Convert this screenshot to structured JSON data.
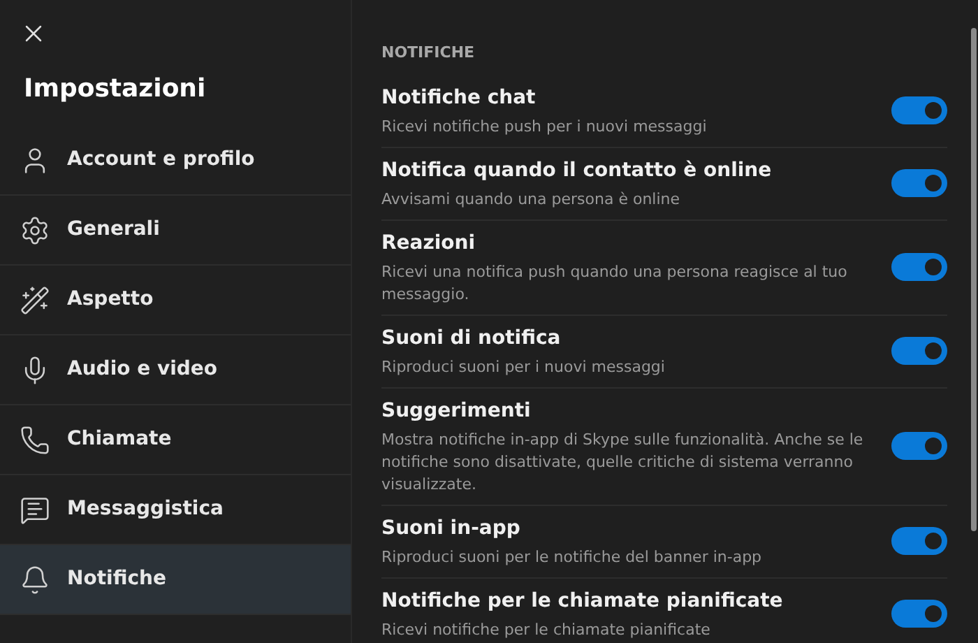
{
  "sidebar": {
    "title": "Impostazioni",
    "items": [
      {
        "kind": "account",
        "label": "Account e profilo",
        "selected": false
      },
      {
        "kind": "general",
        "label": "Generali",
        "selected": false
      },
      {
        "kind": "appearance",
        "label": "Aspetto",
        "selected": false
      },
      {
        "kind": "audio",
        "label": "Audio e video",
        "selected": false
      },
      {
        "kind": "calls",
        "label": "Chiamate",
        "selected": false
      },
      {
        "kind": "messaging",
        "label": "Messaggistica",
        "selected": false
      },
      {
        "kind": "notifications",
        "label": "Notifiche",
        "selected": true
      }
    ]
  },
  "section": {
    "heading": "NOTIFICHE",
    "settings": [
      {
        "title": "Notifiche chat",
        "description": "Ricevi notifiche push per i nuovi messaggi",
        "on": true
      },
      {
        "title": "Notifica quando il contatto è online",
        "description": "Avvisami quando una persona è online",
        "on": true
      },
      {
        "title": "Reazioni",
        "description": "Ricevi una notifica push quando una persona reagisce al tuo messaggio.",
        "on": true
      },
      {
        "title": "Suoni di notifica",
        "description": "Riproduci suoni per i nuovi messaggi",
        "on": true
      },
      {
        "title": "Suggerimenti",
        "description": "Mostra notifiche in-app di Skype sulle funzionalità. Anche se le notifiche sono disattivate, quelle critiche di sistema verranno visualizzate.",
        "on": true
      },
      {
        "title": "Suoni in-app",
        "description": "Riproduci suoni per le notifiche del banner in-app",
        "on": true
      },
      {
        "title": "Notifiche per le chiamate pianificate",
        "description": "Ricevi notifiche per le chiamate pianificate",
        "on": true
      }
    ]
  }
}
